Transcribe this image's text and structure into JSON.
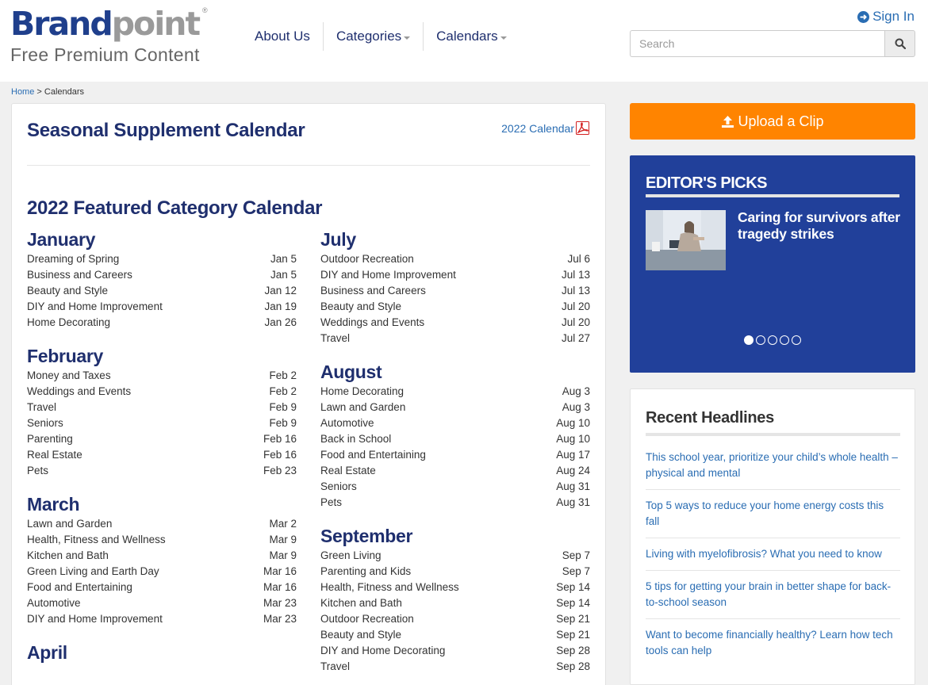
{
  "header": {
    "logo_brand": "Brand",
    "logo_point": "point",
    "logo_reg": "®",
    "tagline": "Free Premium Content",
    "nav": [
      {
        "label": "About Us"
      },
      {
        "label": "Categories"
      },
      {
        "label": "Calendars"
      }
    ],
    "signin_label": "Sign In",
    "search_placeholder": "Search"
  },
  "breadcrumb": {
    "home": "Home",
    "separator": " > ",
    "current": "Calendars"
  },
  "main": {
    "title": "Seasonal Supplement Calendar",
    "calendar_link": "2022 Calendar",
    "featured_title": "2022 Featured Category Calendar",
    "left_months": [
      {
        "name": "January",
        "items": [
          {
            "label": "Dreaming of Spring",
            "date": "Jan 5"
          },
          {
            "label": "Business and Careers",
            "date": "Jan 5"
          },
          {
            "label": "Beauty and Style",
            "date": "Jan 12"
          },
          {
            "label": "DIY and Home Improvement",
            "date": "Jan 19"
          },
          {
            "label": "Home Decorating",
            "date": "Jan 26"
          }
        ]
      },
      {
        "name": "February",
        "items": [
          {
            "label": "Money and Taxes",
            "date": "Feb 2"
          },
          {
            "label": "Weddings and Events",
            "date": "Feb 2"
          },
          {
            "label": "Travel",
            "date": "Feb 9"
          },
          {
            "label": "Seniors",
            "date": "Feb 9"
          },
          {
            "label": "Parenting",
            "date": "Feb 16"
          },
          {
            "label": "Real Estate",
            "date": "Feb 16"
          },
          {
            "label": "Pets",
            "date": "Feb 23"
          }
        ]
      },
      {
        "name": "March",
        "items": [
          {
            "label": "Lawn and Garden",
            "date": "Mar 2"
          },
          {
            "label": "Health, Fitness and Wellness",
            "date": "Mar 9"
          },
          {
            "label": "Kitchen and Bath",
            "date": "Mar 9"
          },
          {
            "label": "Green Living and Earth Day",
            "date": "Mar 16"
          },
          {
            "label": "Food and Entertaining",
            "date": "Mar 16"
          },
          {
            "label": "Automotive",
            "date": "Mar 23"
          },
          {
            "label": "DIY and Home Improvement",
            "date": "Mar 23"
          }
        ]
      },
      {
        "name": "April",
        "items": []
      }
    ],
    "right_months": [
      {
        "name": "July",
        "items": [
          {
            "label": "Outdoor Recreation",
            "date": "Jul 6"
          },
          {
            "label": "DIY and Home Improvement",
            "date": "Jul 13"
          },
          {
            "label": "Business and Careers",
            "date": "Jul 13"
          },
          {
            "label": "Beauty and Style",
            "date": "Jul 20"
          },
          {
            "label": "Weddings and Events",
            "date": "Jul 20"
          },
          {
            "label": "Travel",
            "date": "Jul 27"
          }
        ]
      },
      {
        "name": "August",
        "items": [
          {
            "label": "Home Decorating",
            "date": "Aug 3"
          },
          {
            "label": "Lawn and Garden",
            "date": "Aug 3"
          },
          {
            "label": "Automotive",
            "date": "Aug 10"
          },
          {
            "label": "Back in School",
            "date": "Aug 10"
          },
          {
            "label": "Food and Entertaining",
            "date": "Aug 17"
          },
          {
            "label": "Real Estate",
            "date": "Aug 24"
          },
          {
            "label": "Seniors",
            "date": "Aug 31"
          },
          {
            "label": "Pets",
            "date": "Aug 31"
          }
        ]
      },
      {
        "name": "September",
        "items": [
          {
            "label": "Green Living",
            "date": "Sep 7"
          },
          {
            "label": "Parenting and Kids",
            "date": "Sep 7"
          },
          {
            "label": "Health, Fitness and Wellness",
            "date": "Sep 14"
          },
          {
            "label": "Kitchen and Bath",
            "date": "Sep 14"
          },
          {
            "label": "Outdoor Recreation",
            "date": "Sep 21"
          },
          {
            "label": "Beauty and Style",
            "date": "Sep 21"
          },
          {
            "label": "DIY and Home Decorating",
            "date": "Sep 28"
          },
          {
            "label": "Travel",
            "date": "Sep 28"
          }
        ]
      }
    ]
  },
  "sidebar": {
    "upload_label": "Upload a Clip",
    "editors_picks": {
      "title": "EDITOR'S PICKS",
      "headline": "Caring for survivors after tragedy strikes",
      "slide_count": 5,
      "active_slide": 1
    },
    "recent": {
      "title": "Recent Headlines",
      "items": [
        "This school year, prioritize your child’s whole health – physical and mental",
        "Top 5 ways to reduce your home energy costs this fall",
        "Living with myelofibrosis? What you need to know",
        "5 tips for getting your brain in better shape for back-to-school season",
        "Want to become financially healthy? Learn how tech tools can help"
      ]
    }
  },
  "colors": {
    "brand_blue": "#1f3f8c",
    "brand_gray": "#9a9a9a",
    "heading_navy": "#1f2f6e",
    "link_blue": "#2a6db3",
    "upload_orange": "#ff8400",
    "picks_blue": "#21409a"
  }
}
